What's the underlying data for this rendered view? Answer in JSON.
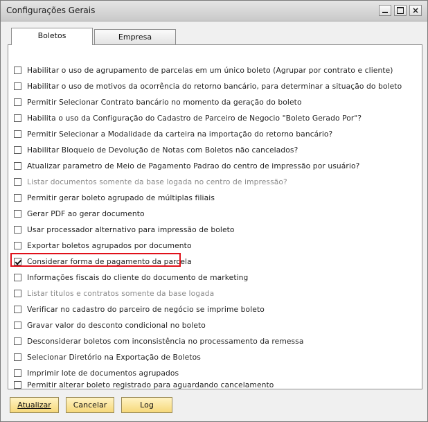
{
  "window": {
    "title": "Configurações Gerais",
    "close_glyph": "×"
  },
  "tabs": [
    {
      "label": "Boletos",
      "active": true
    },
    {
      "label": "Empresa",
      "active": false
    }
  ],
  "options": [
    {
      "label": "Habilitar o uso de agrupamento de parcelas em um único boleto (Agrupar por contrato e cliente)",
      "checked": false,
      "disabled": false
    },
    {
      "label": "Habilitar o uso de motivos da ocorrência do retorno bancário,  para determinar a situação do boleto",
      "checked": false,
      "disabled": false
    },
    {
      "label": "Permitir Selecionar Contrato bancário no momento da geração do boleto",
      "checked": false,
      "disabled": false
    },
    {
      "label": "Habilita o uso da Configuração do Cadastro de Parceiro de Negocio \"Boleto Gerado Por\"?",
      "checked": false,
      "disabled": false
    },
    {
      "label": "Permitir Selecionar a Modalidade da carteira na importação do retorno bancário?",
      "checked": false,
      "disabled": false
    },
    {
      "label": "Habilitar Bloqueio de  Devolução de Notas com Boletos  não cancelados?",
      "checked": false,
      "disabled": false
    },
    {
      "label": "Atualizar parametro de  Meio de Pagamento Padrao do centro de impressão por usuário?",
      "checked": false,
      "disabled": false
    },
    {
      "label": "Listar documentos somente da base logada no centro de impressão?",
      "checked": false,
      "disabled": true
    },
    {
      "label": "Permitir gerar boleto agrupado de múltiplas filiais",
      "checked": false,
      "disabled": false
    },
    {
      "label": "Gerar PDF ao gerar documento",
      "checked": false,
      "disabled": false
    },
    {
      "label": "Usar processador alternativo para impressão de boleto",
      "checked": false,
      "disabled": false
    },
    {
      "label": "Exportar boletos agrupados por documento",
      "checked": false,
      "disabled": false
    },
    {
      "label": "Considerar forma de pagamento da parcela",
      "checked": true,
      "disabled": false
    },
    {
      "label": "Informações fiscais do cliente do documento de marketing",
      "checked": false,
      "disabled": false
    },
    {
      "label": "Listar titulos e contratos somente da base logada",
      "checked": false,
      "disabled": true
    },
    {
      "label": "Verificar no cadastro do parceiro de negócio se imprime boleto",
      "checked": false,
      "disabled": false
    },
    {
      "label": "Gravar valor do desconto condicional  no boleto",
      "checked": false,
      "disabled": false
    },
    {
      "label": "Desconsiderar boletos com inconsistência no processamento da remessa",
      "checked": false,
      "disabled": false
    },
    {
      "label": "Selecionar Diretório na Exportação de Boletos",
      "checked": false,
      "disabled": false
    },
    {
      "label": "Imprimir lote de documentos agrupados",
      "checked": false,
      "disabled": false
    },
    {
      "label": "Permitir alterar boleto registrado para aguardando cancelamento",
      "checked": false,
      "disabled": false
    }
  ],
  "buttons": {
    "update": "Atualizar",
    "cancel": "Cancelar",
    "log": "Log"
  },
  "colors": {
    "highlight_border": "#e0101a",
    "button_bg": "#f6d87a"
  }
}
